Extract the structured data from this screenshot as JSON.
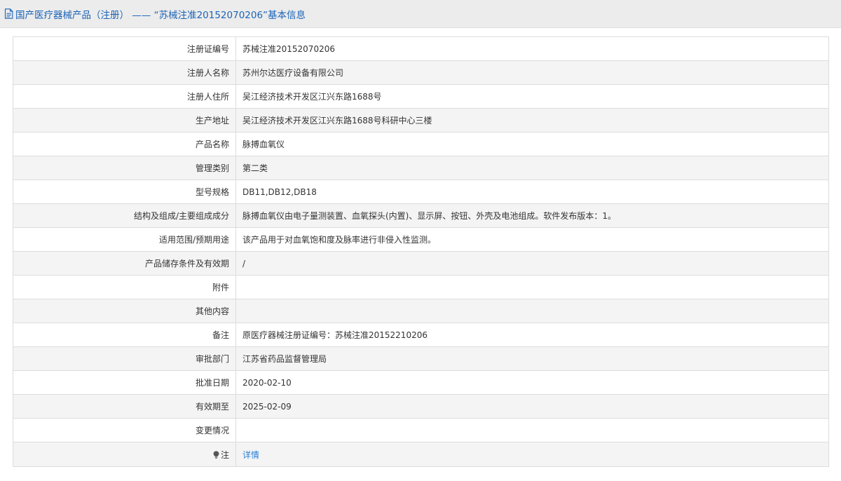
{
  "header": {
    "title": "国产医疗器械产品（注册） —— “苏械注准20152070206”基本信息",
    "icon": "document-icon"
  },
  "colors": {
    "title": "#1a64b8",
    "link": "#2a7fd4",
    "header_bg": "#ececec",
    "row_alt_bg": "#f4f4f4",
    "border": "#dcdcdc"
  },
  "rows": [
    {
      "label": "注册证编号",
      "value": "苏械注准20152070206"
    },
    {
      "label": "注册人名称",
      "value": "苏州尔达医疗设备有限公司"
    },
    {
      "label": "注册人住所",
      "value": "吴江经济技术开发区江兴东路1688号"
    },
    {
      "label": "生产地址",
      "value": "吴江经济技术开发区江兴东路1688号科研中心三楼"
    },
    {
      "label": "产品名称",
      "value": "脉搏血氧仪"
    },
    {
      "label": "管理类别",
      "value": "第二类"
    },
    {
      "label": "型号规格",
      "value": "DB11,DB12,DB18"
    },
    {
      "label": "结构及组成/主要组成成分",
      "value": "脉搏血氧仪由电子量测装置、血氧探头(内置)、显示屏、按钮、外壳及电池组成。软件发布版本：1。"
    },
    {
      "label": "适用范围/预期用途",
      "value": "该产品用于对血氧饱和度及脉率进行非侵入性监测。"
    },
    {
      "label": "产品储存条件及有效期",
      "value": "/"
    },
    {
      "label": "附件",
      "value": ""
    },
    {
      "label": "其他内容",
      "value": ""
    },
    {
      "label": "备注",
      "value": "原医疗器械注册证编号：苏械注准20152210206"
    },
    {
      "label": "审批部门",
      "value": "江苏省药品监督管理局"
    },
    {
      "label": "批准日期",
      "value": "2020-02-10"
    },
    {
      "label": "有效期至",
      "value": "2025-02-09"
    },
    {
      "label": "变更情况",
      "value": ""
    }
  ],
  "note": {
    "label": "注",
    "icon": "lightbulb-icon",
    "link_text": "详情"
  }
}
